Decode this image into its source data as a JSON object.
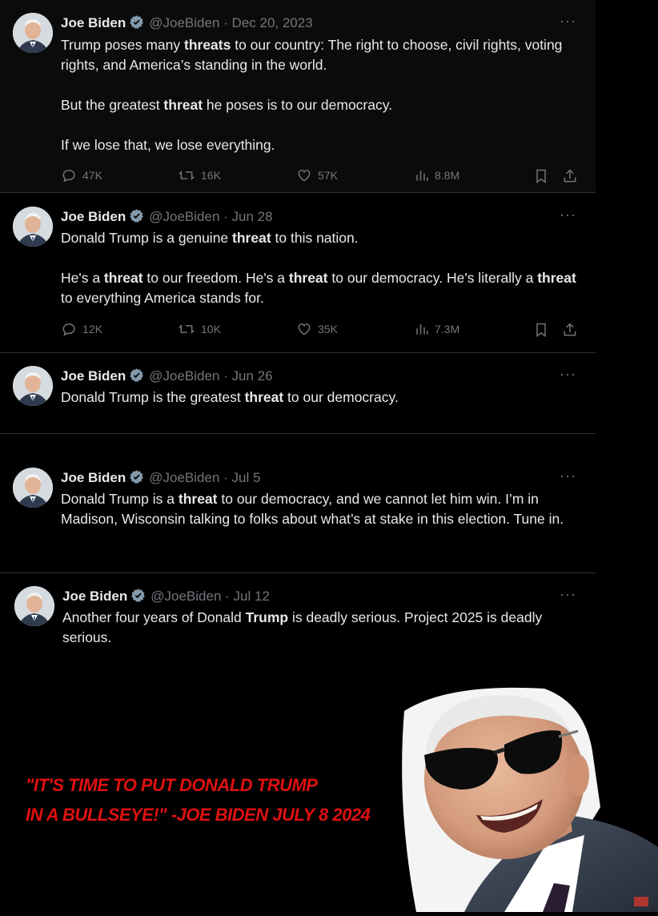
{
  "tweets": [
    {
      "name": "Joe Biden",
      "handle": "@JoeBiden",
      "date": "Dec 20, 2023",
      "paragraphs": [
        [
          {
            "t": "Trump poses many "
          },
          {
            "t": "threats",
            "b": true
          },
          {
            "t": " to our country: The right to choose, civil rights, voting rights, and America’s standing in the world."
          }
        ],
        [
          {
            "t": "But the greatest "
          },
          {
            "t": "threat",
            "b": true
          },
          {
            "t": " he poses is to our democracy."
          }
        ],
        [
          {
            "t": "If we lose that, we lose everything."
          }
        ]
      ],
      "stats": {
        "replies": "47K",
        "reposts": "16K",
        "likes": "57K",
        "views": "8.8M"
      }
    },
    {
      "name": "Joe Biden",
      "handle": "@JoeBiden",
      "date": "Jun 28",
      "paragraphs": [
        [
          {
            "t": "Donald Trump is a genuine "
          },
          {
            "t": "threat",
            "b": true
          },
          {
            "t": " to this nation."
          }
        ],
        [
          {
            "t": "He's a "
          },
          {
            "t": "threat",
            "b": true
          },
          {
            "t": " to our freedom. He's a "
          },
          {
            "t": "threat",
            "b": true
          },
          {
            "t": " to our democracy. He's literally a "
          },
          {
            "t": "threat",
            "b": true
          },
          {
            "t": " to everything America stands for."
          }
        ]
      ],
      "stats": {
        "replies": "12K",
        "reposts": "10K",
        "likes": "35K",
        "views": "7.3M"
      }
    },
    {
      "name": "Joe Biden",
      "handle": "@JoeBiden",
      "date": "Jun 26",
      "paragraphs": [
        [
          {
            "t": "Donald Trump is the greatest "
          },
          {
            "t": "threat",
            "b": true
          },
          {
            "t": " to our democracy."
          }
        ]
      ]
    },
    {
      "name": "Joe Biden",
      "handle": "@JoeBiden",
      "date": "Jul 5",
      "paragraphs": [
        [
          {
            "t": "Donald Trump is a "
          },
          {
            "t": "threat",
            "b": true
          },
          {
            "t": " to our democracy, and we cannot let him win. I’m in Madison, Wisconsin talking to folks about what’s at stake in this election. Tune in."
          }
        ]
      ]
    },
    {
      "name": "Joe Biden",
      "handle": "@JoeBiden",
      "date": "Jul 12",
      "paragraphs": [
        [
          {
            "t": "Another four years of Donald "
          },
          {
            "t": "Trump",
            "b": true
          },
          {
            "t": " is deadly serious. Project 2025 is deadly serious."
          }
        ]
      ]
    }
  ],
  "separator": "·",
  "more_glyph": "···",
  "meme_caption": {
    "line1": "\"IT'S TIME TO PUT DONALD TRUMP",
    "line2": "IN A BULLSEYE!\" -JOE BIDEN JULY 8 2024"
  },
  "colors": {
    "text": "#e7e9ea",
    "muted": "#71767b",
    "verified": "#829aab",
    "caption": "#e0100f",
    "divider": "#2f3336"
  },
  "icons": [
    "verified-badge-icon",
    "reply-icon",
    "repost-icon",
    "like-icon",
    "views-icon",
    "bookmark-icon",
    "share-icon",
    "more-icon"
  ]
}
